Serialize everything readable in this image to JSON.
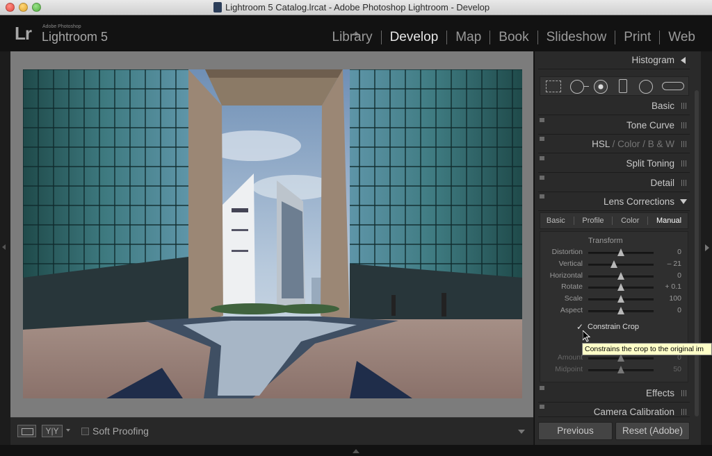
{
  "window": {
    "title": "Lightroom 5 Catalog.lrcat - Adobe Photoshop Lightroom - Develop"
  },
  "brand": {
    "logo": "Lr",
    "small": "Adobe Photoshop",
    "name": "Lightroom 5"
  },
  "modules": [
    {
      "label": "Library",
      "active": false
    },
    {
      "label": "Develop",
      "active": true
    },
    {
      "label": "Map",
      "active": false
    },
    {
      "label": "Book",
      "active": false
    },
    {
      "label": "Slideshow",
      "active": false
    },
    {
      "label": "Print",
      "active": false
    },
    {
      "label": "Web",
      "active": false
    }
  ],
  "panels": {
    "histogram": "Histogram",
    "basic": "Basic",
    "tone_curve": "Tone Curve",
    "hsl": {
      "hsl": "HSL",
      "sep": "/",
      "color": "Color",
      "bw": "B & W"
    },
    "split_toning": "Split Toning",
    "detail": "Detail",
    "lens_corrections": "Lens Corrections",
    "effects": "Effects",
    "camera_calibration": "Camera Calibration"
  },
  "lens_tabs": [
    {
      "label": "Basic",
      "active": false
    },
    {
      "label": "Profile",
      "active": false
    },
    {
      "label": "Color",
      "active": false
    },
    {
      "label": "Manual",
      "active": true
    }
  ],
  "transform": {
    "label": "Transform",
    "sliders": [
      {
        "label": "Distortion",
        "value": "0",
        "position": 0.5
      },
      {
        "label": "Vertical",
        "value": "– 21",
        "position": 0.395
      },
      {
        "label": "Horizontal",
        "value": "0",
        "position": 0.5
      },
      {
        "label": "Rotate",
        "value": "+ 0.1",
        "position": 0.5
      },
      {
        "label": "Scale",
        "value": "100",
        "position": 0.5
      },
      {
        "label": "Aspect",
        "value": "0",
        "position": 0.5
      }
    ]
  },
  "constrain_crop": {
    "check": "✓",
    "label": "Constrain Crop"
  },
  "tooltip": "Constrains the crop to the original im",
  "vignetting": {
    "sliders": [
      {
        "label": "Amount",
        "value": "0",
        "position": 0.5
      },
      {
        "label": "Midpoint",
        "value": "50",
        "position": 0.5
      }
    ]
  },
  "toolbar": {
    "yy": "Y|Y",
    "soft_proofing": "Soft Proofing"
  },
  "buttons": {
    "previous": "Previous",
    "reset": "Reset (Adobe)"
  },
  "icons": {
    "crop": "crop-overlay-icon",
    "spot": "spot-removal-icon",
    "redeye": "red-eye-icon",
    "graduated": "graduated-filter-icon",
    "radial": "radial-filter-icon",
    "brush": "adjustment-brush-icon"
  }
}
